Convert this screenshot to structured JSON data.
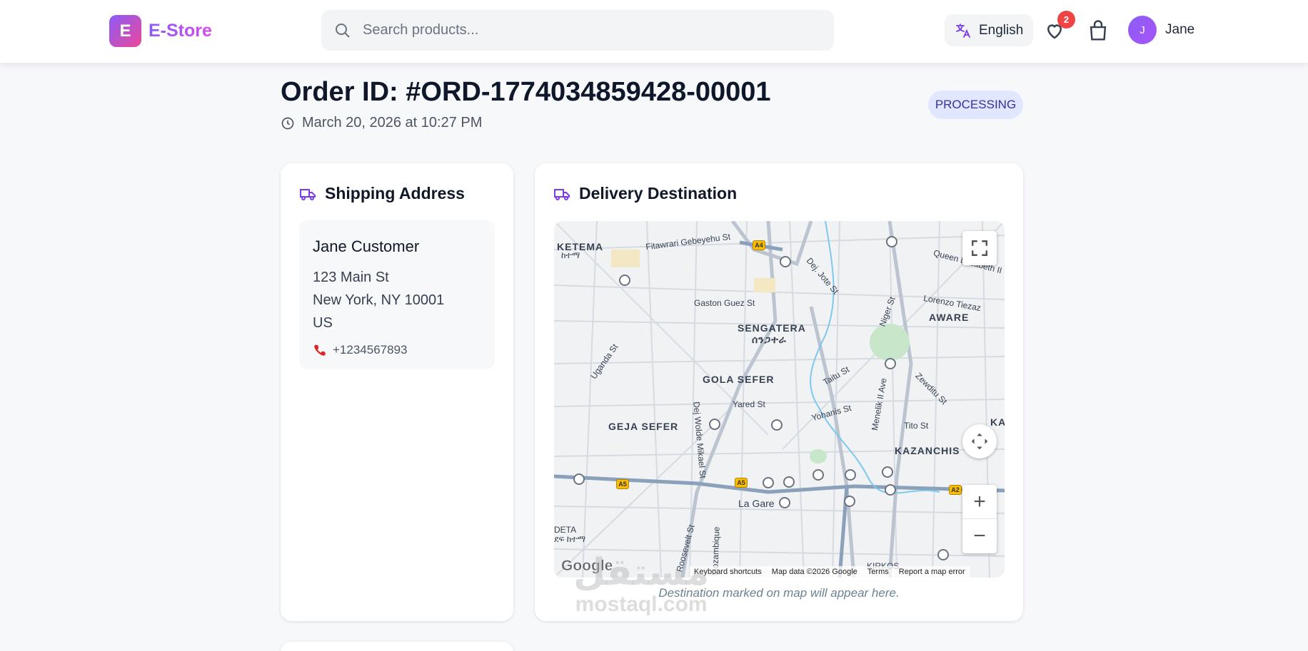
{
  "app": {
    "logo_letter": "E",
    "name": "E-Store",
    "brand_color": "#8b5cf6"
  },
  "header": {
    "search_placeholder": "Search products...",
    "search_icon": "search-icon",
    "language_label": "English",
    "language_icon": "translate-icon",
    "wishlist_icon": "heart-icon",
    "wishlist_count": "2",
    "cart_icon": "shopping-bag-icon",
    "user_initial": "J",
    "user_name": "Jane"
  },
  "order": {
    "title": "Order ID: #ORD-1774034859428-00001",
    "date": "March 20, 2026 at 10:27 PM",
    "date_icon": "clock-icon",
    "status": "PROCESSING",
    "status_color": "#e0e7ff"
  },
  "shipping": {
    "heading": "Shipping Address",
    "icon": "truck-icon",
    "name": "Jane Customer",
    "street": "123 Main St",
    "city_line": "New York, NY 10001",
    "country": "US",
    "phone_icon": "phone-icon",
    "phone": "+1234567893"
  },
  "delivery": {
    "heading": "Delivery Destination",
    "icon": "truck-icon",
    "note": "Destination marked on map will appear here.",
    "map": {
      "areas": [
        {
          "name": "KETEMA",
          "sub": "ከተማ"
        },
        {
          "name": "SENGATERA",
          "sub": "ሰንጋተራ"
        },
        {
          "name": "GOLA SEFER"
        },
        {
          "name": "GEJA SEFER"
        },
        {
          "name": "AWARE"
        },
        {
          "name": "KAZANCHIS"
        },
        {
          "name": "KA"
        },
        {
          "name": "DETA",
          "sub": "ደፍ ከተማ"
        },
        {
          "name": "KIRKOS"
        }
      ],
      "streets": [
        "Fitawrari Gebeyehu St",
        "Gaston Guez St",
        "Dej. Jote St",
        "Uganda St",
        "Niger St",
        "Lorenzo Tiezaz",
        "Queen Elizabeth II",
        "Taitu St",
        "Zewditu St",
        "Yared St",
        "Yohanis St",
        "Menelik II Ave",
        "Tito St",
        "Dej Wolde Mikael St",
        "La Gare",
        "Roosevelt St",
        "Mozambique"
      ],
      "road_shields": [
        "A4",
        "A5",
        "A5",
        "A2"
      ],
      "footer_shortcuts": "Keyboard shortcuts",
      "footer_data": "Map data ©2026 Google",
      "footer_terms": "Terms",
      "footer_report": "Report a map error",
      "google": "Google",
      "zoom_in": "+",
      "zoom_out": "−"
    }
  },
  "watermark": {
    "arabic": "مستقل",
    "latin": "mostaql.com"
  }
}
